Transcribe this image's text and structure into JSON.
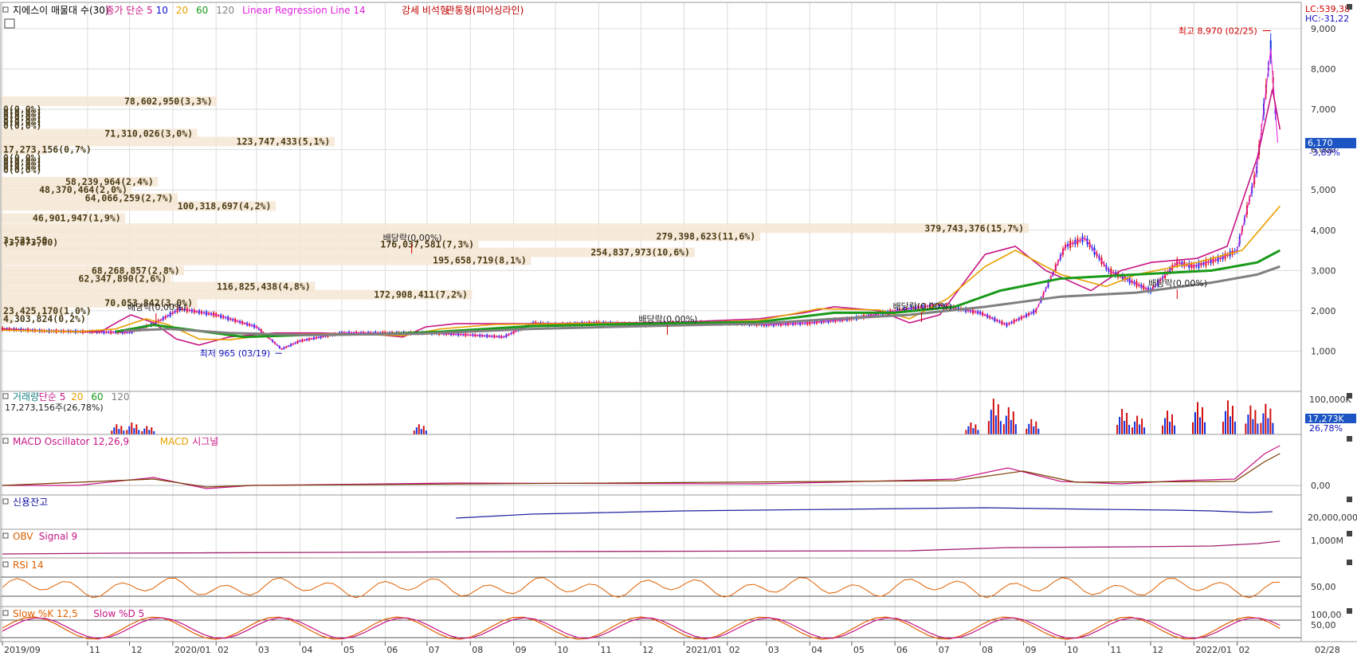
{
  "chart_data": {
    "type": "line",
    "title": "지에스이 매물대 수(30)",
    "price_panel": {
      "legend": [
        {
          "text": "지에스이 매물대 수(30)",
          "color": "#000000"
        },
        {
          "text": "종가 단순 5",
          "color": "#c71585"
        },
        {
          "text": "10",
          "color": "#1010d0"
        },
        {
          "text": "20",
          "color": "#e8a000"
        },
        {
          "text": "60",
          "color": "#1a9a1a"
        },
        {
          "text": "120",
          "color": "#808080"
        },
        {
          "text": "Linear Regression Line 14",
          "color": "#e020e0"
        },
        {
          "text": "강세 비석형",
          "color": "#c00000"
        },
        {
          "text": "관통형(피어싱라인)",
          "color": "#c00000"
        }
      ],
      "lc": "LC:539,38",
      "hc": "HC:-31,22",
      "y_ticks": [
        "9,000",
        "8,000",
        "7,000",
        "6,000",
        "5,000",
        "4,000",
        "3,000",
        "2,000",
        "1,000"
      ],
      "ylim": [
        0,
        9000
      ],
      "current_price": "6,170",
      "current_change": "-3,89%",
      "high_label": "최고 8,970 (02/25)",
      "low_label": "최저 965 (03/19)",
      "dividend_labels": [
        {
          "date": "2019-12-20",
          "text": "배당락(0,00%)"
        },
        {
          "date": "2020-12-20",
          "text": "배당락(0,00%)"
        },
        {
          "date": "2021-06-20",
          "text": "배당락(0,00%)"
        },
        {
          "date": "2021-12-20",
          "text": "배당락(0,00%)"
        },
        {
          "date": "2020-06-20",
          "text": "배당락(0,00%)"
        }
      ],
      "close_series": [
        {
          "date": "2019-09-01",
          "v": 1550
        },
        {
          "date": "2019-10-01",
          "v": 1500
        },
        {
          "date": "2019-11-01",
          "v": 1480
        },
        {
          "date": "2019-12-01",
          "v": 1460
        },
        {
          "date": "2019-12-20",
          "v": 1700
        },
        {
          "date": "2020-01-06",
          "v": 2050
        },
        {
          "date": "2020-02-01",
          "v": 1900
        },
        {
          "date": "2020-03-01",
          "v": 1600
        },
        {
          "date": "2020-03-19",
          "v": 1050
        },
        {
          "date": "2020-04-01",
          "v": 1250
        },
        {
          "date": "2020-05-01",
          "v": 1450
        },
        {
          "date": "2020-06-01",
          "v": 1450
        },
        {
          "date": "2020-07-01",
          "v": 1450
        },
        {
          "date": "2020-08-01",
          "v": 1400
        },
        {
          "date": "2020-08-25",
          "v": 1350
        },
        {
          "date": "2020-09-15",
          "v": 1700
        },
        {
          "date": "2020-10-01",
          "v": 1650
        },
        {
          "date": "2020-11-01",
          "v": 1700
        },
        {
          "date": "2020-12-01",
          "v": 1650
        },
        {
          "date": "2021-01-01",
          "v": 1700
        },
        {
          "date": "2021-02-01",
          "v": 1700
        },
        {
          "date": "2021-03-01",
          "v": 1650
        },
        {
          "date": "2021-04-01",
          "v": 1700
        },
        {
          "date": "2021-05-01",
          "v": 1800
        },
        {
          "date": "2021-06-01",
          "v": 2000
        },
        {
          "date": "2021-07-01",
          "v": 2150
        },
        {
          "date": "2021-08-01",
          "v": 1950
        },
        {
          "date": "2021-08-20",
          "v": 1650
        },
        {
          "date": "2021-09-10",
          "v": 2000
        },
        {
          "date": "2021-10-01",
          "v": 3600
        },
        {
          "date": "2021-10-15",
          "v": 3800
        },
        {
          "date": "2021-11-01",
          "v": 3000
        },
        {
          "date": "2021-12-01",
          "v": 2500
        },
        {
          "date": "2021-12-20",
          "v": 3200
        },
        {
          "date": "2022-01-01",
          "v": 3100
        },
        {
          "date": "2022-01-20",
          "v": 3300
        },
        {
          "date": "2022-02-01",
          "v": 3500
        },
        {
          "date": "2022-02-15",
          "v": 5500
        },
        {
          "date": "2022-02-25",
          "v": 8500
        },
        {
          "date": "2022-03-02",
          "v": 6170
        }
      ],
      "ma_series": [
        {
          "name": "5",
          "color": "#c71585",
          "values": [
            [
              0,
              1550
            ],
            [
              0.05,
              1500
            ],
            [
              0.1,
              1480
            ],
            [
              0.13,
              1480
            ],
            [
              0.155,
              1750
            ],
            [
              0.17,
              1900
            ],
            [
              0.2,
              1700
            ],
            [
              0.23,
              1300
            ],
            [
              0.26,
              1150
            ],
            [
              0.3,
              1350
            ],
            [
              0.36,
              1450
            ],
            [
              0.42,
              1450
            ],
            [
              0.5,
              1400
            ],
            [
              0.53,
              1350
            ],
            [
              0.56,
              1600
            ],
            [
              0.6,
              1680
            ],
            [
              0.7,
              1680
            ],
            [
              0.8,
              1700
            ],
            [
              0.9,
              1720
            ],
            [
              1.0,
              1800
            ],
            [
              1.06,
              1950
            ],
            [
              1.1,
              2100
            ],
            [
              1.16,
              2000
            ],
            [
              1.2,
              1700
            ],
            [
              1.24,
              1900
            ],
            [
              1.3,
              3400
            ],
            [
              1.34,
              3600
            ],
            [
              1.38,
              3000
            ],
            [
              1.44,
              2500
            ],
            [
              1.48,
              3000
            ],
            [
              1.52,
              3200
            ],
            [
              1.58,
              3300
            ],
            [
              1.62,
              3600
            ],
            [
              1.66,
              5800
            ],
            [
              1.68,
              7500
            ],
            [
              1.69,
              6500
            ]
          ]
        },
        {
          "name": "20",
          "color": "#e8a000",
          "values": [
            [
              0,
              1520
            ],
            [
              0.1,
              1480
            ],
            [
              0.15,
              1550
            ],
            [
              0.19,
              1800
            ],
            [
              0.22,
              1650
            ],
            [
              0.26,
              1300
            ],
            [
              0.3,
              1280
            ],
            [
              0.36,
              1420
            ],
            [
              0.45,
              1430
            ],
            [
              0.53,
              1380
            ],
            [
              0.58,
              1550
            ],
            [
              0.65,
              1660
            ],
            [
              0.8,
              1690
            ],
            [
              0.9,
              1700
            ],
            [
              1.0,
              1760
            ],
            [
              1.08,
              2050
            ],
            [
              1.16,
              2020
            ],
            [
              1.2,
              1800
            ],
            [
              1.25,
              2300
            ],
            [
              1.3,
              3100
            ],
            [
              1.34,
              3500
            ],
            [
              1.4,
              2900
            ],
            [
              1.46,
              2600
            ],
            [
              1.5,
              2900
            ],
            [
              1.58,
              3200
            ],
            [
              1.64,
              3500
            ],
            [
              1.69,
              4600
            ]
          ]
        },
        {
          "name": "60",
          "color": "#1a9a1a",
          "values": [
            [
              0.15,
              1480
            ],
            [
              0.2,
              1650
            ],
            [
              0.26,
              1500
            ],
            [
              0.32,
              1350
            ],
            [
              0.4,
              1400
            ],
            [
              0.5,
              1420
            ],
            [
              0.58,
              1480
            ],
            [
              0.7,
              1620
            ],
            [
              0.85,
              1680
            ],
            [
              1.0,
              1720
            ],
            [
              1.1,
              1950
            ],
            [
              1.18,
              1950
            ],
            [
              1.26,
              2100
            ],
            [
              1.32,
              2500
            ],
            [
              1.4,
              2800
            ],
            [
              1.5,
              2900
            ],
            [
              1.6,
              3000
            ],
            [
              1.66,
              3200
            ],
            [
              1.69,
              3500
            ]
          ]
        },
        {
          "name": "120",
          "color": "#808080",
          "values": [
            [
              0.16,
              1500
            ],
            [
              0.22,
              1550
            ],
            [
              0.3,
              1450
            ],
            [
              0.4,
              1400
            ],
            [
              0.55,
              1430
            ],
            [
              0.7,
              1550
            ],
            [
              0.85,
              1620
            ],
            [
              1.0,
              1680
            ],
            [
              1.1,
              1800
            ],
            [
              1.2,
              1900
            ],
            [
              1.3,
              2100
            ],
            [
              1.4,
              2350
            ],
            [
              1.5,
              2450
            ],
            [
              1.6,
              2700
            ],
            [
              1.66,
              2900
            ],
            [
              1.69,
              3100
            ]
          ]
        }
      ],
      "volume_profile": [
        {
          "price": 7200,
          "label": "78,602,950(3,3%)",
          "pct": 3.3
        },
        {
          "price": 7000,
          "label": "0(0,0%)",
          "pct": 0
        },
        {
          "price": 6900,
          "label": "0(0,0%)",
          "pct": 0
        },
        {
          "price": 6800,
          "label": "0(0,0%)",
          "pct": 0
        },
        {
          "price": 6700,
          "label": "0(0,0%)",
          "pct": 0
        },
        {
          "price": 6600,
          "label": "0(0,0%)",
          "pct": 0
        },
        {
          "price": 6400,
          "label": "71,310,026(3,0%)",
          "pct": 3.0
        },
        {
          "price": 6200,
          "label": "123,747,433(5,1%)",
          "pct": 5.1
        },
        {
          "price": 6000,
          "label": "17,273,156(0,7%)",
          "pct": 0.7
        },
        {
          "price": 5800,
          "label": "0(0,0%)",
          "pct": 0
        },
        {
          "price": 5700,
          "label": "0(0,0%)",
          "pct": 0
        },
        {
          "price": 5600,
          "label": "0(0,0%)",
          "pct": 0
        },
        {
          "price": 5500,
          "label": "0(0,0%)",
          "pct": 0
        },
        {
          "price": 5200,
          "label": "58,239,964(2,4%)",
          "pct": 2.4
        },
        {
          "price": 5000,
          "label": "48,370,464(2,0%)",
          "pct": 2.0
        },
        {
          "price": 4800,
          "label": "64,066,259(2,7%)",
          "pct": 2.7
        },
        {
          "price": 4600,
          "label": "100,318,697(4,2%)",
          "pct": 4.2
        },
        {
          "price": 4300,
          "label": "46,901,947(1,9%)",
          "pct": 1.9
        },
        {
          "price": 4050,
          "label": "379,743,376(15,7%)",
          "pct": 15.7
        },
        {
          "price": 3850,
          "label": "279,398,623(11,6%)",
          "pct": 11.6
        },
        {
          "price": 3650,
          "label": "176,037,581(7,3%)",
          "pct": 7.3
        },
        {
          "price": 3450,
          "label": "254,837,973(10,6%)",
          "pct": 10.6
        },
        {
          "price": 3250,
          "label": "195,658,719(8,1%)",
          "pct": 8.1
        },
        {
          "price": 3000,
          "label": "68,268,857(2,8%)",
          "pct": 2.8
        },
        {
          "price": 2800,
          "label": "62,347,890(2,6%)",
          "pct": 2.6
        },
        {
          "price": 2600,
          "label": "116,825,438(4,8%)",
          "pct": 4.8
        },
        {
          "price": 2400,
          "label": "172,908,411(7,2%)",
          "pct": 7.2
        },
        {
          "price": 2200,
          "label": "70,053,842(3,0%)",
          "pct": 3.0
        },
        {
          "price": 2000,
          "label": "23,425,170(1,0%)",
          "pct": 1.0
        },
        {
          "price": 1800,
          "label": "4,303,824(0,2%)",
          "pct": 0.2
        },
        {
          "price": 3700,
          "label": "(3,873,00)",
          "pct": 0
        },
        {
          "price": 3750,
          "label": "3,531,50",
          "pct": 0
        }
      ]
    },
    "volume_panel": {
      "legend": [
        {
          "text": "거래량",
          "color": "#1a8080"
        },
        {
          "text": "단순 5",
          "color": "#c71585"
        },
        {
          "text": "20",
          "color": "#e8a000"
        },
        {
          "text": "60",
          "color": "#1a9a1a"
        },
        {
          "text": "120",
          "color": "#808080"
        }
      ],
      "sub": "17,273,156주(26,78%)",
      "y_tick": "100,000K",
      "current": "17,273K",
      "pct": "26,78%"
    },
    "macd_panel": {
      "legend": [
        {
          "text": "MACD Oscillator 12,26,9",
          "color": "#c71585"
        },
        {
          "text": "MACD",
          "color": "#e8a000"
        },
        {
          "text": "시그널",
          "color": "#c71585"
        }
      ],
      "y_tick": "0,00"
    },
    "credit_panel": {
      "legend": [
        {
          "text": "신용잔고",
          "color": "#1010a0"
        }
      ],
      "y_tick": "20,000,000"
    },
    "obv_panel": {
      "legend": [
        {
          "text": "OBV",
          "color": "#e06000"
        },
        {
          "text": "Signal 9",
          "color": "#c71585"
        }
      ],
      "y_tick": "1,000M"
    },
    "rsi_panel": {
      "legend": [
        {
          "text": "RSI 14",
          "color": "#e06000"
        }
      ],
      "y_tick": "50,00"
    },
    "stoch_panel": {
      "legend": [
        {
          "text": "Slow %K 12,5",
          "color": "#e06000"
        },
        {
          "text": "Slow %D 5",
          "color": "#c71585"
        }
      ],
      "y_ticks": [
        "100,00",
        "50,00"
      ]
    },
    "x_ticks": [
      {
        "label": "2019/09",
        "date": "2019-09-01"
      },
      {
        "label": "11",
        "date": "2019-11-01"
      },
      {
        "label": "12",
        "date": "2019-12-01"
      },
      {
        "label": "2020/01",
        "date": "2020-01-01"
      },
      {
        "label": "02",
        "date": "2020-02-01"
      },
      {
        "label": "03",
        "date": "2020-03-01"
      },
      {
        "label": "04",
        "date": "2020-04-01"
      },
      {
        "label": "05",
        "date": "2020-05-01"
      },
      {
        "label": "06",
        "date": "2020-06-01"
      },
      {
        "label": "07",
        "date": "2020-07-01"
      },
      {
        "label": "08",
        "date": "2020-08-01"
      },
      {
        "label": "09",
        "date": "2020-09-01"
      },
      {
        "label": "10",
        "date": "2020-10-01"
      },
      {
        "label": "11",
        "date": "2020-11-01"
      },
      {
        "label": "12",
        "date": "2020-12-01"
      },
      {
        "label": "2021/01",
        "date": "2021-01-01"
      },
      {
        "label": "02",
        "date": "2021-02-01"
      },
      {
        "label": "03",
        "date": "2021-03-01"
      },
      {
        "label": "04",
        "date": "2021-04-01"
      },
      {
        "label": "05",
        "date": "2021-05-01"
      },
      {
        "label": "06",
        "date": "2021-06-01"
      },
      {
        "label": "07",
        "date": "2021-07-01"
      },
      {
        "label": "08",
        "date": "2021-08-01"
      },
      {
        "label": "09",
        "date": "2021-09-01"
      },
      {
        "label": "10",
        "date": "2021-10-01"
      },
      {
        "label": "11",
        "date": "2021-11-01"
      },
      {
        "label": "12",
        "date": "2021-12-01"
      },
      {
        "label": "2022/01",
        "date": "2022-01-01"
      },
      {
        "label": "02",
        "date": "2022-02-01"
      }
    ],
    "x_end_label": "02/28"
  }
}
